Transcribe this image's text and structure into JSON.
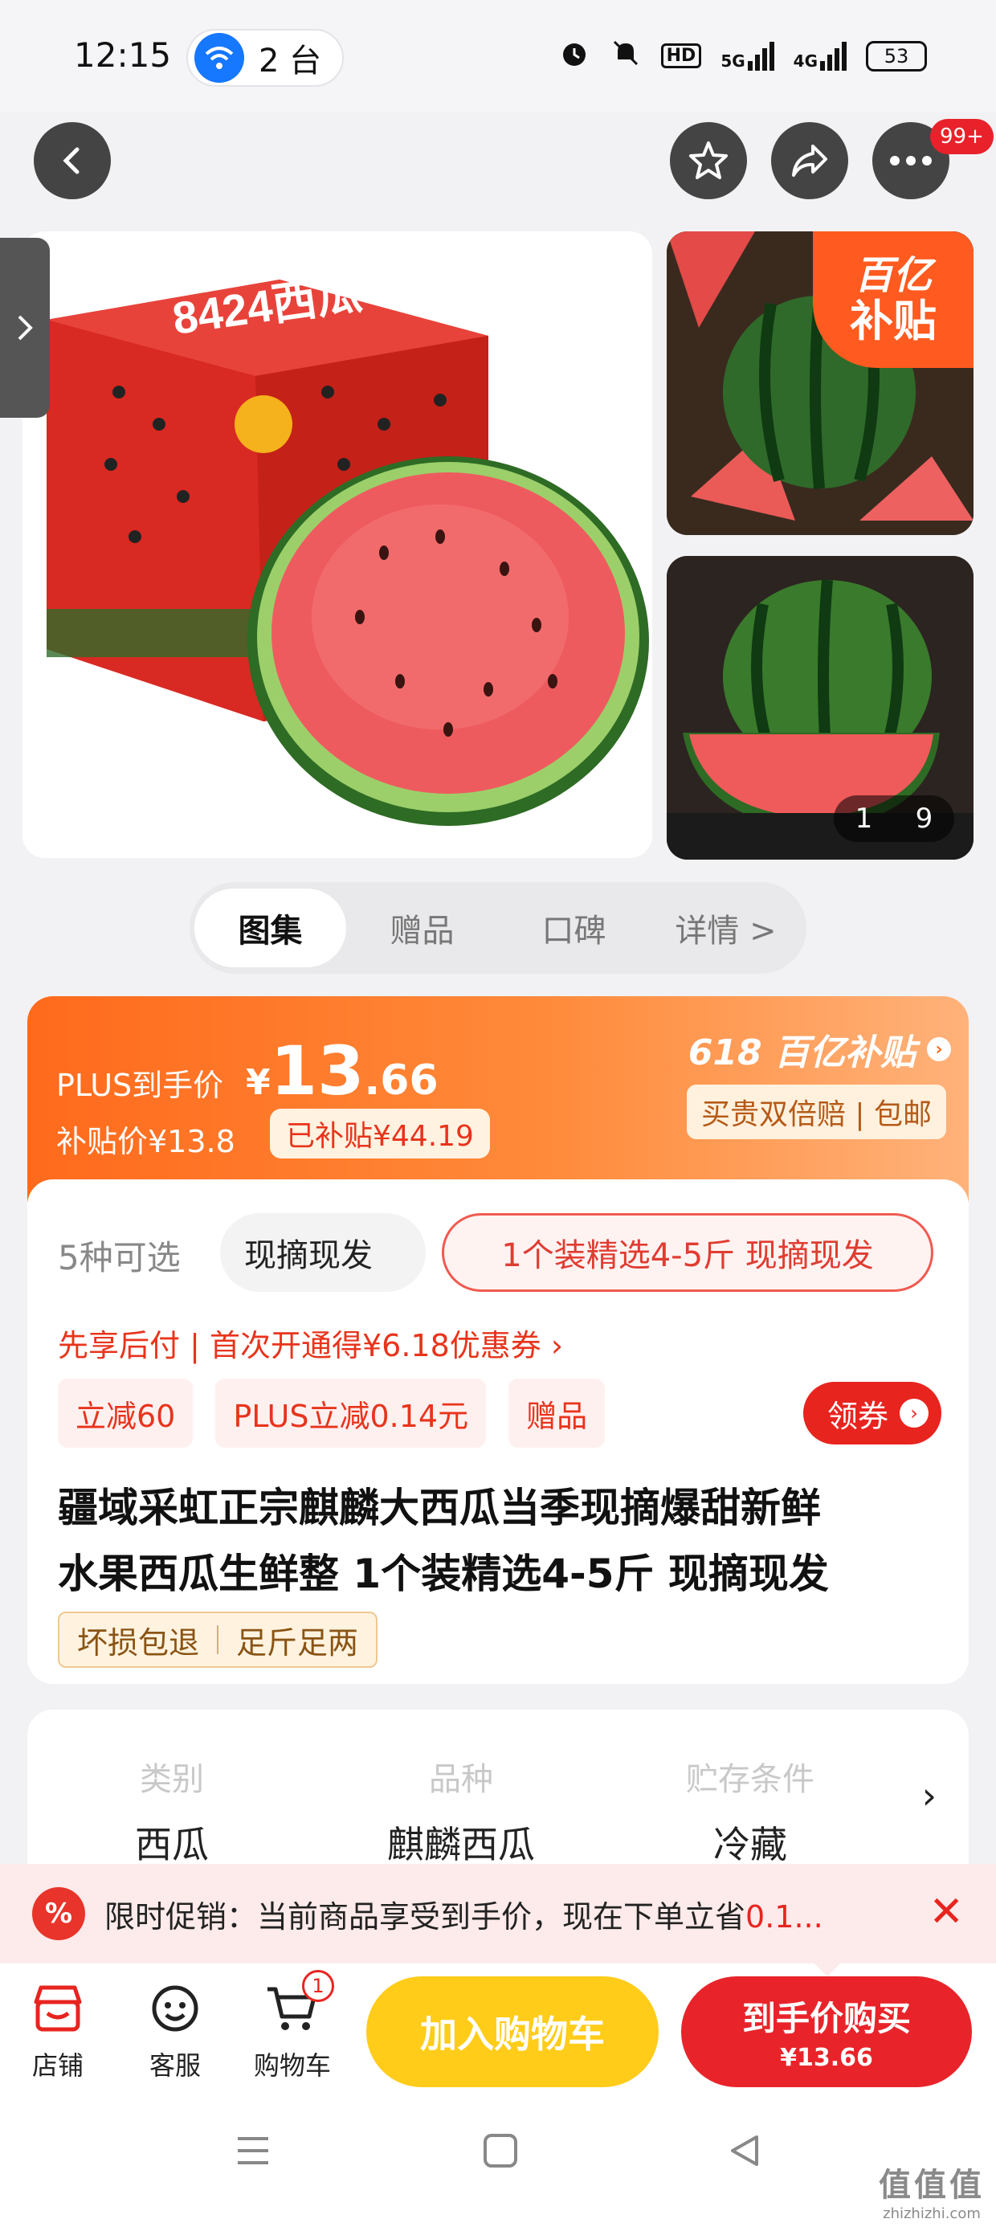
{
  "status_bar": {
    "time": "12:15",
    "devices": "2 台",
    "hd_tag": "HD",
    "net1": "5G",
    "net2": "4G",
    "battery": "53"
  },
  "nav": {
    "cart_badge": "99+"
  },
  "gallery": {
    "box_text": "8424西瓜",
    "badge_line1": "百亿",
    "badge_line2": "补贴",
    "pager_current": "1",
    "pager_total": "9"
  },
  "tabs": [
    {
      "label": "图集"
    },
    {
      "label": "赠品"
    },
    {
      "label": "口碑"
    },
    {
      "label": "详情 >"
    }
  ],
  "price": {
    "plus_label": "PLUS到手价",
    "currency": "¥",
    "plus_int": "13",
    "plus_dec": ".66",
    "subsidy_price": "补贴价¥13.8",
    "subsidy_tag": "已补贴¥44.19",
    "brand": "618 百亿补贴",
    "brand_tag": "买贵双倍赔 | 包邮"
  },
  "options": {
    "count": "5种可选",
    "chip1": "现摘现发",
    "chip2": "1个装精选4-5斤 现摘现发"
  },
  "credit_line": "先享后付 | 首次开通得¥6.18优惠券 ›",
  "promo_chips": [
    "立减60",
    "PLUS立减0.14元",
    "赠品"
  ],
  "coupon_label": "领券",
  "product_title_line1": "疆域采虹正宗麒麟大西瓜当季现摘爆甜新鲜",
  "product_title_line2": "水果西瓜生鲜整 1个装精选4-5斤 现摘现发",
  "guarantees": [
    "坏损包退",
    "足斤足两"
  ],
  "specs": [
    {
      "key": "类别",
      "value": "西瓜"
    },
    {
      "key": "品种",
      "value": "麒麟西瓜"
    },
    {
      "key": "贮存条件",
      "value": "冷藏"
    }
  ],
  "promo_banner": {
    "icon": "%",
    "text": "限时促销：当前商品享受到手价，现在下单立省",
    "amount": "0.1..."
  },
  "bottom_bar": {
    "store": "店铺",
    "service": "客服",
    "cart": "购物车",
    "cart_count": "1",
    "add_to_cart": "加入购物车",
    "buy_now": "到手价购买",
    "buy_price": "¥13.66"
  },
  "watermark": {
    "line1": "值值值",
    "line2": "zhizhizhi.com"
  },
  "colors": {
    "accent_red": "#e8242a",
    "orange": "#ff6a1c",
    "yellow": "#ffcc1a"
  }
}
